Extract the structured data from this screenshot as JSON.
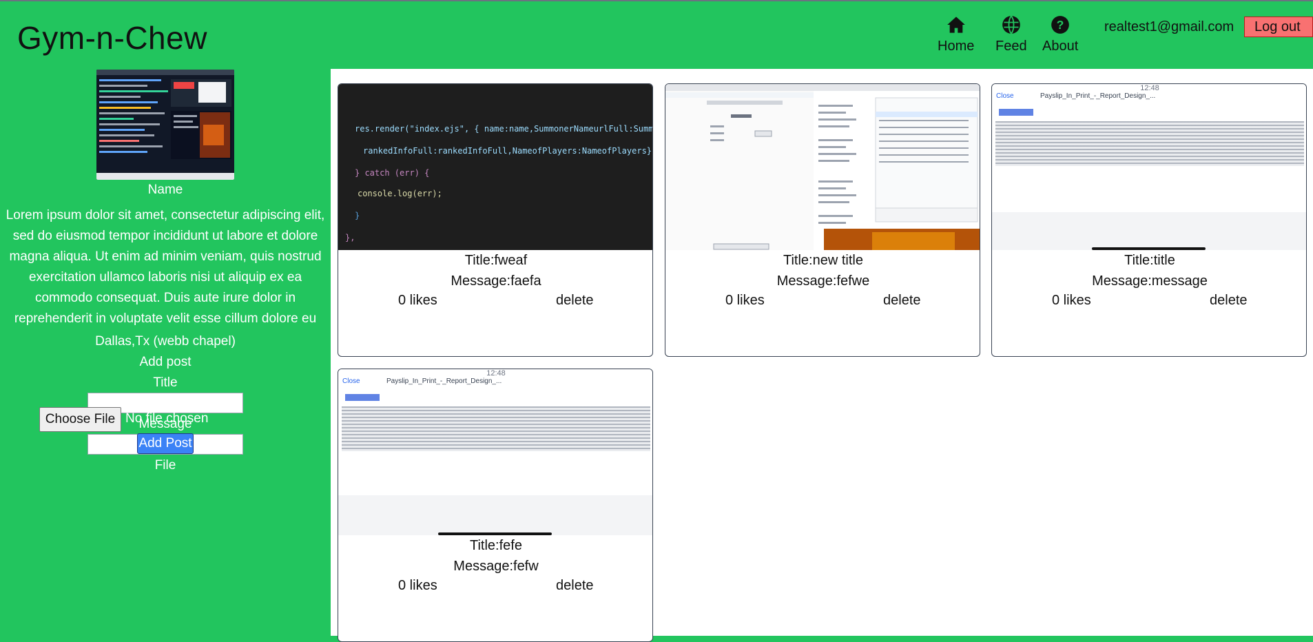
{
  "app": {
    "brand": "Gym-n-Chew"
  },
  "nav": [
    {
      "label": "Home",
      "icon": "home-icon"
    },
    {
      "label": "Feed",
      "icon": "globe-icon"
    },
    {
      "label": "About",
      "icon": "question-circle-icon"
    }
  ],
  "user": {
    "email": "realtest1@gmail.com",
    "logout_label": "Log out"
  },
  "sidebar": {
    "name": "Name",
    "bio": "Lorem ipsum dolor sit amet, consectetur adipiscing elit, sed do eiusmod tempor incididunt ut labore et dolore magna aliqua. Ut enim ad minim veniam, quis nostrud exercitation ullamco laboris nisi ut aliquip ex ea commodo consequat. Duis aute irure dolor in reprehenderit in voluptate velit esse cillum dolore eu",
    "location": "Dallas,Tx (webb chapel)",
    "add_post_heading": "Add post",
    "title_label": "Title",
    "message_label": "Message",
    "file_label": "File",
    "choose_file_label": "Choose File",
    "no_file_text": "No file chosen",
    "add_post_button": "Add Post"
  },
  "posts": [
    {
      "title": "Title:fweaf",
      "message": "Message:faefa",
      "likes": "0 likes",
      "delete": "delete",
      "image": "code-screenshot"
    },
    {
      "title": "Title:new title",
      "message": "Message:fefwe",
      "likes": "0 likes",
      "delete": "delete",
      "image": "app-screenshot"
    },
    {
      "title": "Title:title",
      "message": "Message:message",
      "likes": "0 likes",
      "delete": "delete",
      "image": "payslip-screenshot"
    },
    {
      "title": "Title:fefe",
      "message": "Message:fefw",
      "likes": "0 likes",
      "delete": "delete",
      "image": "payslip-screenshot"
    }
  ],
  "code_thumb": {
    "line1": "res.render(\"index.ejs\", { name:name,SummonerNameurlFull:SummonerNameurlFull,profilePicURL:profilePicURL,",
    "line2": "rankedInfoFull:rankedInfoFull,NameofPlayers:NameofPlayers});",
    "line3": "} catch (err) {",
    "line4": "console.log(err);",
    "line5": "}",
    "line6": "},"
  },
  "payslip_thumb": {
    "header": "Payslip_In_Print_-_Report_Design_...",
    "close": "Close",
    "time": "12:48"
  },
  "colors": {
    "background": "#22c55e",
    "logout": "#f87171",
    "add_post": "#3b82f6"
  }
}
